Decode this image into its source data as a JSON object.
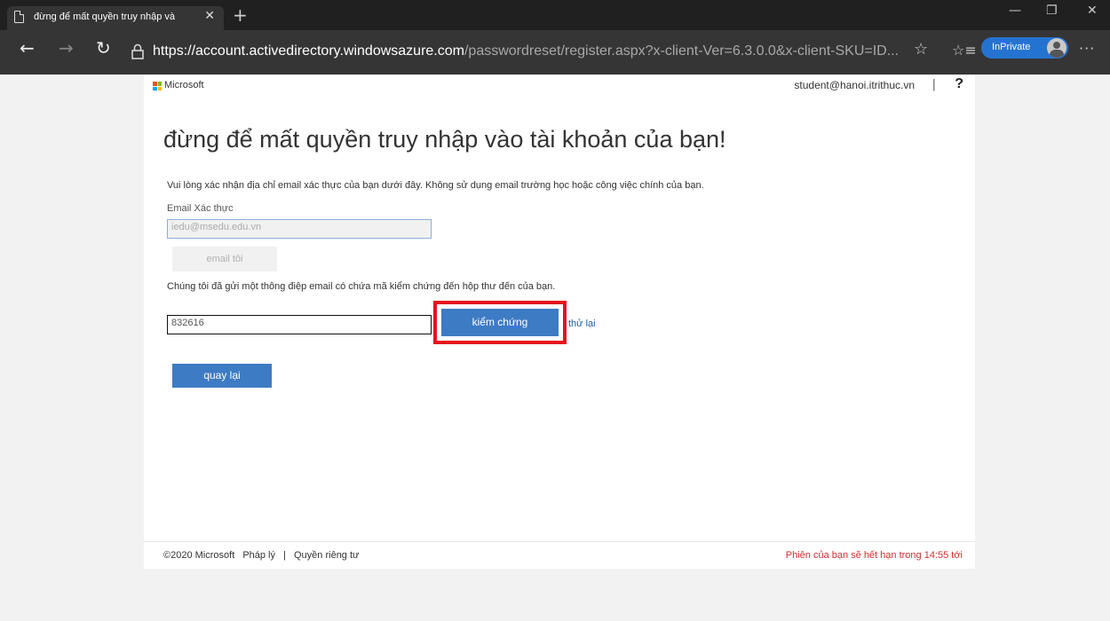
{
  "browser": {
    "tab_title": "đừng để mất quyền truy nhập và",
    "tab_close": "✕",
    "new_tab": "+",
    "url_host": "https://account.activedirectory.windowsazure.com",
    "url_path": "/passwordreset/register.aspx?x-client-Ver=6.3.0.0&x-client-SKU=ID...",
    "inprivate_label": "InPrivate",
    "more": "···"
  },
  "header": {
    "brand": "Microsoft",
    "user_email": "student@hanoi.itrithuc.vn",
    "separator": "|",
    "help": "?"
  },
  "main": {
    "heading": "đừng để mất quyền truy nhập vào tài khoản của bạn!",
    "intro": "Vui lòng xác nhận địa chỉ email xác thực của bạn dưới đây. Không sử dụng email trường học hoặc công việc chính của bạn.",
    "email_label": "Email Xác thực",
    "email_value": "iedu@msedu.edu.vn",
    "email_button": "email tôi",
    "sent_message": "Chúng tôi đã gửi một thông điệp email có chứa mã kiểm chứng đến hộp thư đến của bạn.",
    "code_value": "832616",
    "verify_button": "kiểm chứng",
    "retry_link": "thử lại",
    "back_button": "quay lại"
  },
  "footer": {
    "copyright": "©2020 Microsoft",
    "legal": "Pháp lý",
    "divider": "|",
    "privacy": "Quyền riêng tư",
    "session_expiry": "Phiên của bạn sẽ hết hạn trong 14:55 tới"
  },
  "colors": {
    "accent": "#3d7bc4",
    "highlight": "#e5131d",
    "expiry_text": "#d03030"
  }
}
